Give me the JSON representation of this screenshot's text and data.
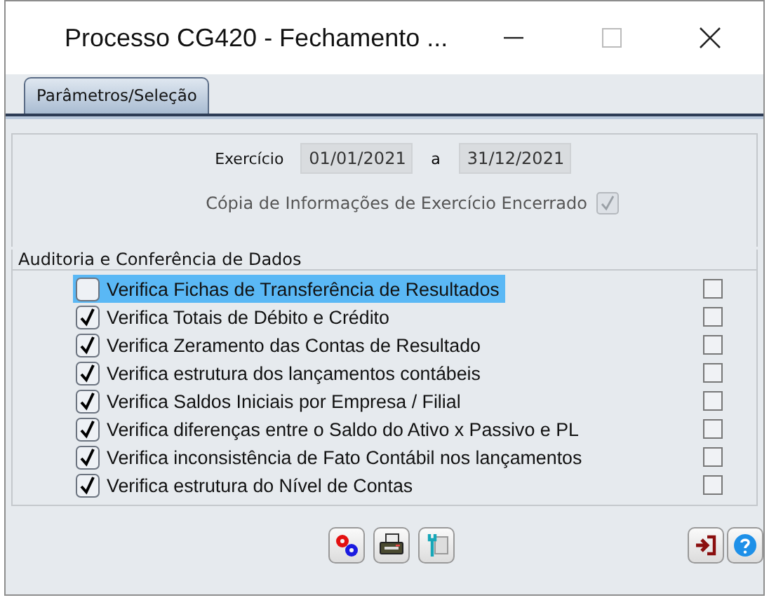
{
  "window": {
    "title": "Processo CG420 - Fechamento ..."
  },
  "tabs": [
    {
      "label": "Parâmetros/Seleção",
      "selected": true
    }
  ],
  "period": {
    "label": "Exercício",
    "start": "01/01/2021",
    "separator": "a",
    "end": "31/12/2021"
  },
  "copy_closed": {
    "label": "Cópia de Informações de Exercício Encerrado",
    "checked": true,
    "disabled": true
  },
  "audit": {
    "title": "Auditoria e Conferência de Dados",
    "items": [
      {
        "label": "Verifica Fichas de Transferência de Resultados",
        "checked": false,
        "selected": true,
        "right_checked": false
      },
      {
        "label": "Verifica Totais de Débito e Crédito",
        "checked": true,
        "selected": false,
        "right_checked": false
      },
      {
        "label": "Verifica Zeramento das Contas de Resultado",
        "checked": true,
        "selected": false,
        "right_checked": false
      },
      {
        "label": "Verifica estrutura dos lançamentos contábeis",
        "checked": true,
        "selected": false,
        "right_checked": false
      },
      {
        "label": "Verifica Saldos Iniciais por Empresa / Filial",
        "checked": true,
        "selected": false,
        "right_checked": false
      },
      {
        "label": "Verifica diferenças entre o Saldo do Ativo x Passivo e PL",
        "checked": true,
        "selected": false,
        "right_checked": false
      },
      {
        "label": "Verifica inconsistência de Fato Contábil nos lançamentos",
        "checked": true,
        "selected": false,
        "right_checked": false
      },
      {
        "label": "Verifica estrutura do Nível de Contas",
        "checked": true,
        "selected": false,
        "right_checked": false
      }
    ]
  }
}
